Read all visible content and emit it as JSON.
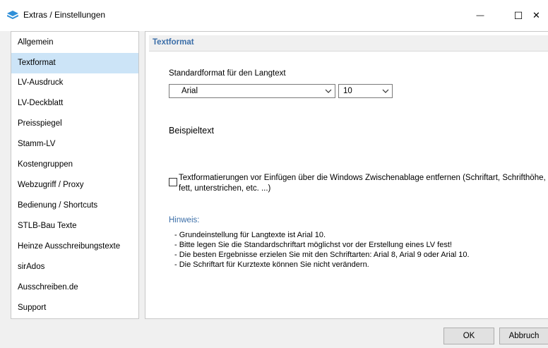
{
  "window": {
    "title": "Extras / Einstellungen",
    "accent_color": "#3b6ea8",
    "minimize_glyph": "—",
    "maximize_glyph": "☐",
    "close_glyph": "✕"
  },
  "sidebar": {
    "selected": "Textformat",
    "items": [
      {
        "label": "Allgemein"
      },
      {
        "label": "Textformat"
      },
      {
        "label": "LV-Ausdruck"
      },
      {
        "label": "LV-Deckblatt"
      },
      {
        "label": "Preisspiegel"
      },
      {
        "label": "Stamm-LV"
      },
      {
        "label": "Kostengruppen"
      },
      {
        "label": "Webzugriff / Proxy"
      },
      {
        "label": "Bedienung / Shortcuts"
      },
      {
        "label": "STLB-Bau Texte"
      },
      {
        "label": "Heinze Ausschreibungstexte"
      },
      {
        "label": "sirAdos"
      },
      {
        "label": "Ausschreiben.de"
      },
      {
        "label": "Support"
      }
    ]
  },
  "panel": {
    "title": "Textformat",
    "format_label": "Standardformat für den Langtext",
    "font_select": {
      "value": "Arial"
    },
    "size_select": {
      "value": "10"
    },
    "sample_text": "Beispieltext",
    "checkbox": {
      "checked": false,
      "label_line1": "Textformatierungen vor Einfügen über die Windows Zwischenablage entfernen (Schriftart, Schrifthöhe,",
      "label_line2": "fett, unterstrichen, etc. ...)"
    },
    "hint": {
      "title": "Hinweis:",
      "lines": [
        "- Grundeinstellung für Langtexte ist Arial 10.",
        "- Bitte legen Sie die Standardschriftart möglichst vor der Erstellung eines LV fest!",
        "- Die besten Ergebnisse erzielen Sie mit den Schriftarten: Arial 8, Arial 9 oder Arial 10.",
        "- Die Schriftart für Kurztexte können Sie nicht verändern."
      ]
    }
  },
  "buttons": {
    "ok": "OK",
    "cancel": "Abbruch"
  }
}
